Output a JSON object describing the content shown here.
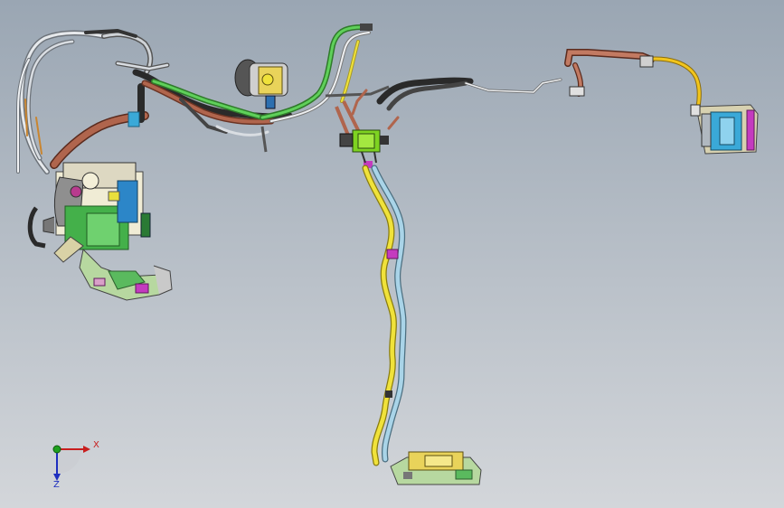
{
  "viewport": {
    "background_top": "#9aa6b3",
    "background_bottom": "#d3d6da"
  },
  "axes": {
    "x_label": "X",
    "z_label": "Z",
    "x_color": "#c81e1e",
    "y_color": "#1ea01e",
    "z_color": "#1e2fbf"
  },
  "colors": {
    "green_tube": "#3fb53a",
    "yellow_tube": "#f0e23a",
    "light_blue_tube": "#a9d4e8",
    "copper_tube": "#b0654d",
    "dark_hose": "#2a2a2a",
    "silver_tube": "#d9dde2",
    "magenta_part": "#c43bbf",
    "cyan_part": "#3aa9d8"
  }
}
